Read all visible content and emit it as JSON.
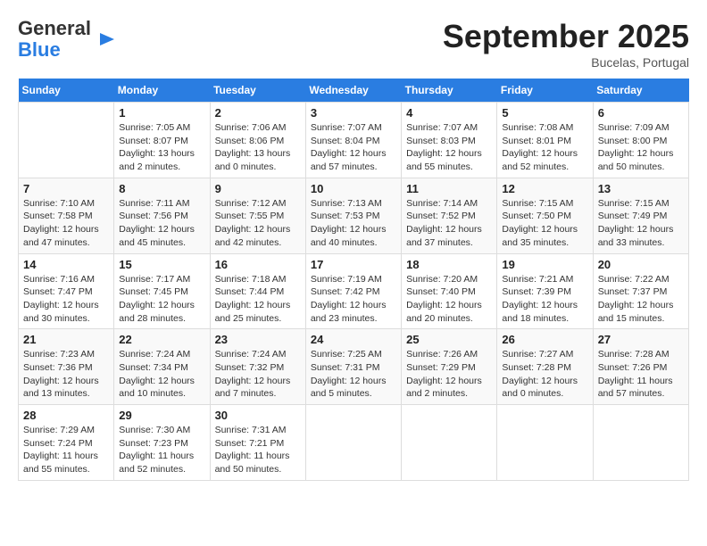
{
  "header": {
    "logo_line1": "General",
    "logo_line2": "Blue",
    "month": "September 2025",
    "location": "Bucelas, Portugal"
  },
  "days_of_week": [
    "Sunday",
    "Monday",
    "Tuesday",
    "Wednesday",
    "Thursday",
    "Friday",
    "Saturday"
  ],
  "weeks": [
    [
      {
        "day": "",
        "info": ""
      },
      {
        "day": "1",
        "info": "Sunrise: 7:05 AM\nSunset: 8:07 PM\nDaylight: 13 hours\nand 2 minutes."
      },
      {
        "day": "2",
        "info": "Sunrise: 7:06 AM\nSunset: 8:06 PM\nDaylight: 13 hours\nand 0 minutes."
      },
      {
        "day": "3",
        "info": "Sunrise: 7:07 AM\nSunset: 8:04 PM\nDaylight: 12 hours\nand 57 minutes."
      },
      {
        "day": "4",
        "info": "Sunrise: 7:07 AM\nSunset: 8:03 PM\nDaylight: 12 hours\nand 55 minutes."
      },
      {
        "day": "5",
        "info": "Sunrise: 7:08 AM\nSunset: 8:01 PM\nDaylight: 12 hours\nand 52 minutes."
      },
      {
        "day": "6",
        "info": "Sunrise: 7:09 AM\nSunset: 8:00 PM\nDaylight: 12 hours\nand 50 minutes."
      }
    ],
    [
      {
        "day": "7",
        "info": "Sunrise: 7:10 AM\nSunset: 7:58 PM\nDaylight: 12 hours\nand 47 minutes."
      },
      {
        "day": "8",
        "info": "Sunrise: 7:11 AM\nSunset: 7:56 PM\nDaylight: 12 hours\nand 45 minutes."
      },
      {
        "day": "9",
        "info": "Sunrise: 7:12 AM\nSunset: 7:55 PM\nDaylight: 12 hours\nand 42 minutes."
      },
      {
        "day": "10",
        "info": "Sunrise: 7:13 AM\nSunset: 7:53 PM\nDaylight: 12 hours\nand 40 minutes."
      },
      {
        "day": "11",
        "info": "Sunrise: 7:14 AM\nSunset: 7:52 PM\nDaylight: 12 hours\nand 37 minutes."
      },
      {
        "day": "12",
        "info": "Sunrise: 7:15 AM\nSunset: 7:50 PM\nDaylight: 12 hours\nand 35 minutes."
      },
      {
        "day": "13",
        "info": "Sunrise: 7:15 AM\nSunset: 7:49 PM\nDaylight: 12 hours\nand 33 minutes."
      }
    ],
    [
      {
        "day": "14",
        "info": "Sunrise: 7:16 AM\nSunset: 7:47 PM\nDaylight: 12 hours\nand 30 minutes."
      },
      {
        "day": "15",
        "info": "Sunrise: 7:17 AM\nSunset: 7:45 PM\nDaylight: 12 hours\nand 28 minutes."
      },
      {
        "day": "16",
        "info": "Sunrise: 7:18 AM\nSunset: 7:44 PM\nDaylight: 12 hours\nand 25 minutes."
      },
      {
        "day": "17",
        "info": "Sunrise: 7:19 AM\nSunset: 7:42 PM\nDaylight: 12 hours\nand 23 minutes."
      },
      {
        "day": "18",
        "info": "Sunrise: 7:20 AM\nSunset: 7:40 PM\nDaylight: 12 hours\nand 20 minutes."
      },
      {
        "day": "19",
        "info": "Sunrise: 7:21 AM\nSunset: 7:39 PM\nDaylight: 12 hours\nand 18 minutes."
      },
      {
        "day": "20",
        "info": "Sunrise: 7:22 AM\nSunset: 7:37 PM\nDaylight: 12 hours\nand 15 minutes."
      }
    ],
    [
      {
        "day": "21",
        "info": "Sunrise: 7:23 AM\nSunset: 7:36 PM\nDaylight: 12 hours\nand 13 minutes."
      },
      {
        "day": "22",
        "info": "Sunrise: 7:24 AM\nSunset: 7:34 PM\nDaylight: 12 hours\nand 10 minutes."
      },
      {
        "day": "23",
        "info": "Sunrise: 7:24 AM\nSunset: 7:32 PM\nDaylight: 12 hours\nand 7 minutes."
      },
      {
        "day": "24",
        "info": "Sunrise: 7:25 AM\nSunset: 7:31 PM\nDaylight: 12 hours\nand 5 minutes."
      },
      {
        "day": "25",
        "info": "Sunrise: 7:26 AM\nSunset: 7:29 PM\nDaylight: 12 hours\nand 2 minutes."
      },
      {
        "day": "26",
        "info": "Sunrise: 7:27 AM\nSunset: 7:28 PM\nDaylight: 12 hours\nand 0 minutes."
      },
      {
        "day": "27",
        "info": "Sunrise: 7:28 AM\nSunset: 7:26 PM\nDaylight: 11 hours\nand 57 minutes."
      }
    ],
    [
      {
        "day": "28",
        "info": "Sunrise: 7:29 AM\nSunset: 7:24 PM\nDaylight: 11 hours\nand 55 minutes."
      },
      {
        "day": "29",
        "info": "Sunrise: 7:30 AM\nSunset: 7:23 PM\nDaylight: 11 hours\nand 52 minutes."
      },
      {
        "day": "30",
        "info": "Sunrise: 7:31 AM\nSunset: 7:21 PM\nDaylight: 11 hours\nand 50 minutes."
      },
      {
        "day": "",
        "info": ""
      },
      {
        "day": "",
        "info": ""
      },
      {
        "day": "",
        "info": ""
      },
      {
        "day": "",
        "info": ""
      }
    ]
  ]
}
